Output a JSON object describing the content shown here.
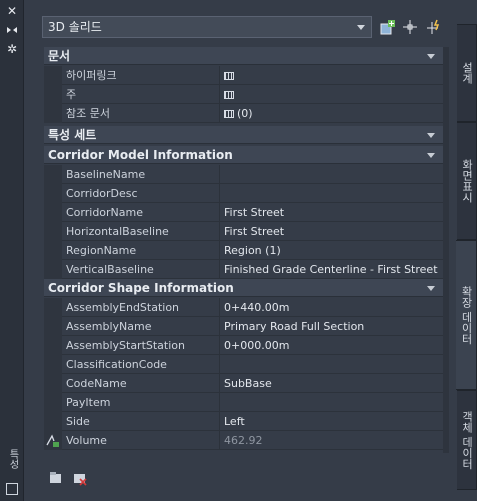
{
  "object_type": "3D 솔리드",
  "left_strip": {
    "title": "특성",
    "icons": [
      "close-icon",
      "auto-hide-icon",
      "settings-icon"
    ]
  },
  "tabs": [
    {
      "label": "설계",
      "active": false
    },
    {
      "label": "화면표시",
      "active": false
    },
    {
      "label": "확장 데이터",
      "active": true
    },
    {
      "label": "객체 데이터",
      "active": false
    }
  ],
  "toolbar": {
    "icons": [
      "toggle-pickadd-icon",
      "select-objects-icon",
      "quick-select-icon"
    ]
  },
  "categories": [
    {
      "title": "문서",
      "rows": [
        {
          "name": "하이퍼링크",
          "value": "",
          "table_icon": true
        },
        {
          "name": "주",
          "value": "",
          "table_icon": true
        },
        {
          "name": "참조 문서",
          "value": "(0)",
          "table_icon": true
        }
      ]
    },
    {
      "title": "특성 세트",
      "rows": []
    },
    {
      "title": "Corridor Model Information",
      "rows": [
        {
          "name": "BaselineName",
          "value": ""
        },
        {
          "name": "CorridorDesc",
          "value": ""
        },
        {
          "name": "CorridorName",
          "value": "First Street"
        },
        {
          "name": "HorizontalBaseline",
          "value": "First Street"
        },
        {
          "name": "RegionName",
          "value": "Region (1)"
        },
        {
          "name": "VerticalBaseline",
          "value": "Finished Grade Centerline - First Street"
        }
      ]
    },
    {
      "title": "Corridor Shape Information",
      "rows": [
        {
          "name": "AssemblyEndStation",
          "value": "0+440.00m"
        },
        {
          "name": "AssemblyName",
          "value": "Primary Road Full Section"
        },
        {
          "name": "AssemblyStartStation",
          "value": "0+000.00m"
        },
        {
          "name": "ClassificationCode",
          "value": ""
        },
        {
          "name": "CodeName",
          "value": "SubBase"
        },
        {
          "name": "PayItem",
          "value": ""
        },
        {
          "name": "Side",
          "value": "Left"
        },
        {
          "name": "Volume",
          "value": "462.92",
          "dim": true,
          "formula_icon": true
        }
      ]
    }
  ],
  "bottom_tools": [
    "add-property-set-icon",
    "remove-property-set-icon"
  ]
}
